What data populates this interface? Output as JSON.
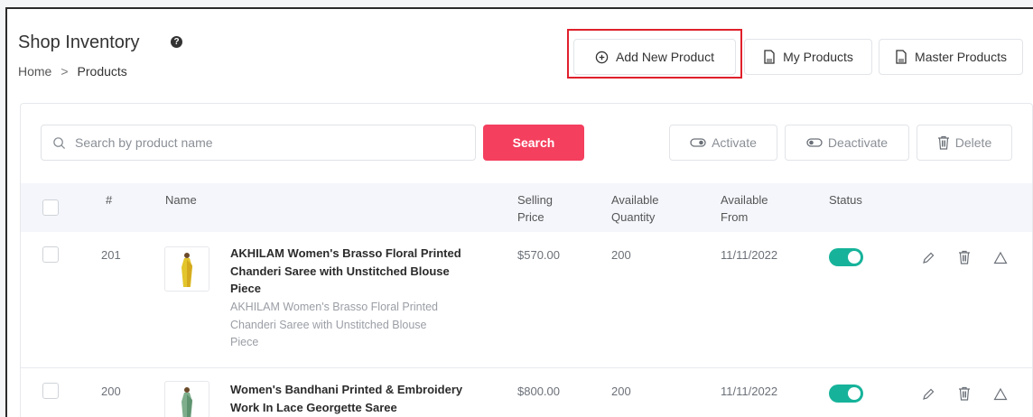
{
  "header": {
    "title": "Shop Inventory",
    "help_icon": "help-icon",
    "breadcrumb": {
      "home": "Home",
      "separator": ">",
      "current": "Products"
    },
    "buttons": {
      "add_new_product": "Add New Product",
      "my_products": "My Products",
      "master_products": "Master Products"
    }
  },
  "toolbar": {
    "search_placeholder": "Search by product name",
    "search_button": "Search",
    "activate": "Activate",
    "deactivate": "Deactivate",
    "delete": "Delete"
  },
  "table": {
    "columns": {
      "index": "#",
      "name": "Name",
      "selling_price_1": "Selling",
      "selling_price_2": "Price",
      "available_quantity_1": "Available",
      "available_quantity_2": "Quantity",
      "available_from_1": "Available",
      "available_from_2": "From",
      "status": "Status"
    },
    "rows": [
      {
        "id": "201",
        "name_lines": [
          "AKHILAM Women's Brasso Floral Printed",
          "Chanderi Saree with Unstitched Blouse",
          "Piece"
        ],
        "desc_lines": [
          "AKHILAM Women's Brasso Floral Printed",
          "Chanderi Saree with Unstitched Blouse",
          "Piece"
        ],
        "price": "$570.00",
        "quantity": "200",
        "available_from": "11/11/2022",
        "status_active": true
      },
      {
        "id": "200",
        "name_lines": [
          "Women's Bandhani Printed & Embroidery",
          "Work In Lace Georgette Saree"
        ],
        "desc_lines": [],
        "price": "$800.00",
        "quantity": "200",
        "available_from": "11/11/2022",
        "status_active": true
      }
    ]
  },
  "colors": {
    "accent": "#f43f5e",
    "highlight_border": "#e0202b",
    "toggle_on": "#16b39a"
  }
}
